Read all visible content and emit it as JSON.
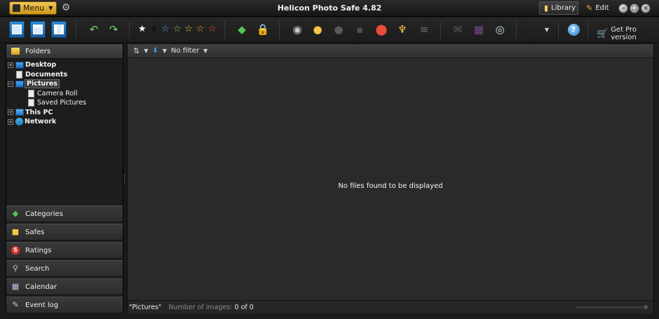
{
  "app": {
    "title": "Helicon Photo Safe 4.82",
    "menu_label": "Menu",
    "tabs": [
      {
        "label": "Library",
        "active": true
      },
      {
        "label": "Edit",
        "active": false
      }
    ]
  },
  "toolbar": {
    "view_buttons": [
      "view-large-icons",
      "view-medium-icons",
      "view-details"
    ],
    "star_ratings": [
      {
        "symbol": "★",
        "color": "#ffffff"
      },
      {
        "symbol": "★",
        "color": "#111111"
      },
      {
        "symbol": "☆",
        "color": "#4aa8ff"
      },
      {
        "symbol": "☆",
        "color": "#7cd94a"
      },
      {
        "symbol": "☆",
        "color": "#f0d24a"
      },
      {
        "symbol": "☆",
        "color": "#ff9b2b"
      },
      {
        "symbol": "☆",
        "color": "#ff4a3a"
      }
    ],
    "get_pro_label": "Get Pro version"
  },
  "sidebar": {
    "folders_label": "Folders",
    "tree": [
      {
        "label": "Desktop",
        "expandable": true,
        "icon": "desktop-icon",
        "selected": false
      },
      {
        "label": "Documents",
        "expandable": false,
        "icon": "documents-icon",
        "selected": false
      },
      {
        "label": "Pictures",
        "expandable": true,
        "icon": "pictures-icon",
        "selected": true
      },
      {
        "label": "Camera Roll",
        "child": true,
        "icon": "file-icon"
      },
      {
        "label": "Saved Pictures",
        "child": true,
        "icon": "file-icon"
      },
      {
        "label": "This PC",
        "expandable": true,
        "icon": "computer-icon",
        "selected": false
      },
      {
        "label": "Network",
        "expandable": true,
        "icon": "network-icon",
        "selected": false
      }
    ],
    "sections": [
      {
        "label": "Categories",
        "icon": "tag-icon"
      },
      {
        "label": "Safes",
        "icon": "lock-icon"
      },
      {
        "label": "Ratings",
        "icon": "ratings-icon"
      },
      {
        "label": "Search",
        "icon": "search-icon"
      },
      {
        "label": "Calendar",
        "icon": "calendar-icon"
      },
      {
        "label": "Event log",
        "icon": "event-log-icon"
      }
    ]
  },
  "main": {
    "filter_label": "No filter",
    "empty_message": "No files found to be displayed",
    "status": {
      "current_folder": "\"Pictures\"",
      "count_label": "Number of images:",
      "count_value": "0 of 0"
    }
  },
  "colors": {
    "accent_gold": "#e0b02c",
    "background": "#2a2a2a",
    "panel": "#1d1d1d"
  }
}
